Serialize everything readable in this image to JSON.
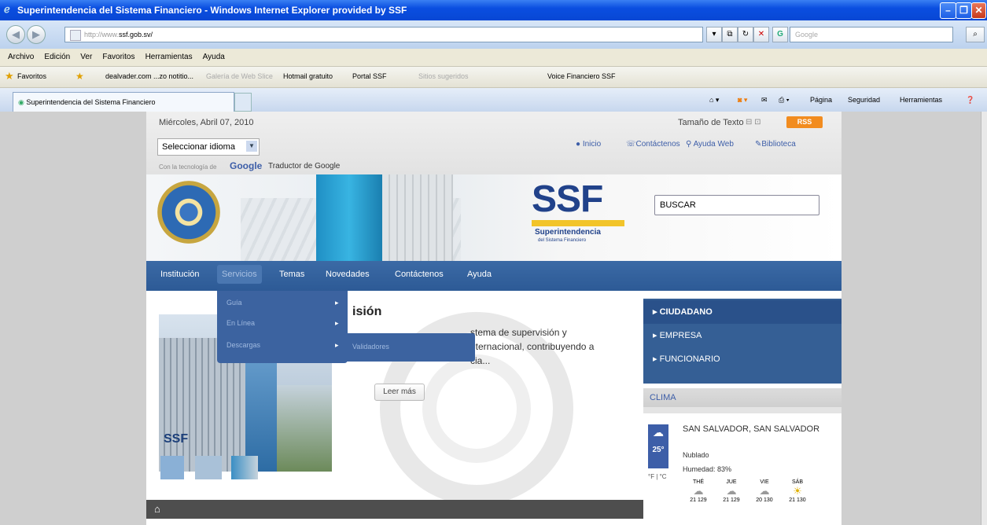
{
  "window": {
    "title": "Superintendencia del Sistema Financiero - Windows Internet Explorer provided by SSF"
  },
  "address": {
    "prefix": "http://www.",
    "domain": "ssf.gob.sv/",
    "search_placeholder": "Google"
  },
  "menu": [
    "Archivo",
    "Edición",
    "Ver",
    "Favoritos",
    "Herramientas",
    "Ayuda"
  ],
  "favorites": {
    "label": "Favoritos",
    "items": [
      "dealvader.com ...zo notitio...",
      "Galería de Web Slice",
      "Hotmail gratuito",
      "Portal SSF",
      "Sitios sugeridos",
      "Voice Financiero SSF"
    ]
  },
  "tab": {
    "label": "Superintendencia del Sistema Financiero"
  },
  "commandbar": [
    "Página",
    "Seguridad",
    "Herramientas"
  ],
  "site": {
    "date": "Miércoles, Abril 07, 2010",
    "text_size_label": "Tamaño de Texto",
    "rss": "RSS",
    "language_select": "Seleccionar idioma",
    "powered_prefix": "Con la tecnología de",
    "google_logo": "Google",
    "translator": "Traductor de Google",
    "toplinks": [
      "Inicio",
      "Contáctenos",
      "Ayuda Web",
      "Biblioteca"
    ],
    "logo_text": "SSF",
    "logo_line1": "Superintendencia",
    "logo_line2": "del Sistema Financiero",
    "search_value": "BUSCAR",
    "nav": [
      "Institución",
      "Servicios",
      "Temas",
      "Novedades",
      "Contáctenos",
      "Ayuda"
    ],
    "dropdown": [
      "Guía",
      "En Línea",
      "Descargas"
    ],
    "submenu": [
      "Validadores"
    ],
    "article_title": "isión",
    "article_line1": "stema de supervisión y",
    "article_line2": "nternacional, contribuyendo a",
    "article_line3": "cia...",
    "read_more": "Leer más",
    "audience": [
      "CIUDADANO",
      "EMPRESA",
      "FUNCIONARIO"
    ],
    "clima_title": "CLIMA",
    "city": "SAN SALVADOR, SAN SALVADOR",
    "temp": "25°",
    "units": "°F | °C",
    "condition": "Nublado",
    "humidity": "Humedad: 83%",
    "forecast": [
      {
        "day": "THÉ",
        "temps": "21 129"
      },
      {
        "day": "JUE",
        "temps": "21 129"
      },
      {
        "day": "VIE",
        "temps": "20 130"
      },
      {
        "day": "SÁB",
        "temps": "21 130"
      }
    ]
  }
}
